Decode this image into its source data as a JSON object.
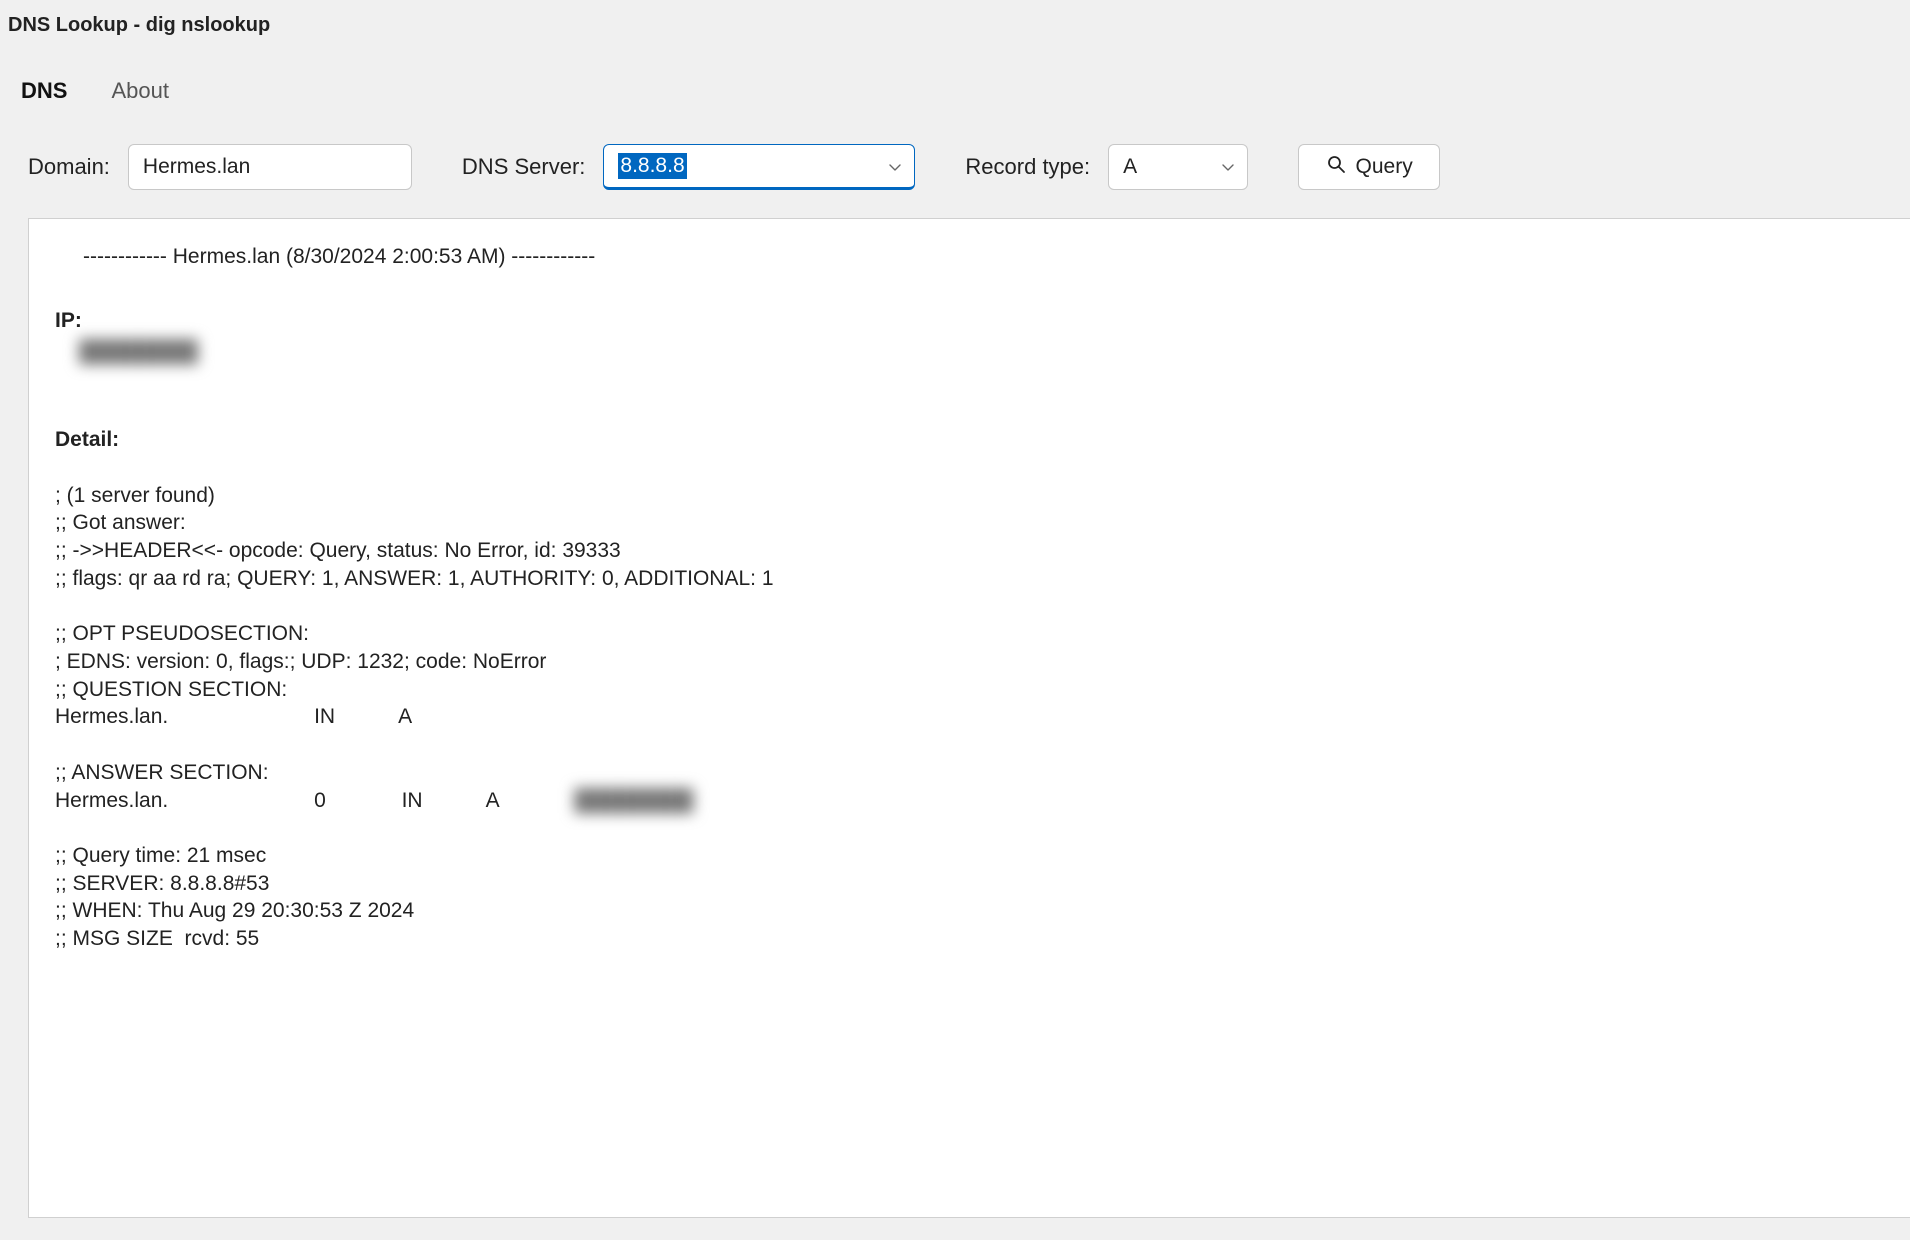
{
  "window": {
    "title": "DNS Lookup - dig nslookup"
  },
  "tabs": {
    "dns": "DNS",
    "about": "About",
    "active": "dns"
  },
  "controls": {
    "domain_label": "Domain:",
    "domain_value": "Hermes.lan",
    "dns_label": "DNS Server:",
    "dns_value": "8.8.8.8",
    "record_label": "Record type:",
    "record_value": "A",
    "query_label": "Query"
  },
  "output": {
    "separator": "------------ Hermes.lan (8/30/2024 2:00:53 AM) ------------",
    "ip_label": "IP:",
    "ip_value_redacted": "████████",
    "detail_label": "Detail:",
    "detail_lines": {
      "l01": "; (1 server found)",
      "l02": ";; Got answer:",
      "l03": ";; ->>HEADER<<- opcode: Query, status: No Error, id: 39333",
      "l04": ";; flags: qr aa rd ra; QUERY: 1, ANSWER: 1, AUTHORITY: 0, ADDITIONAL: 1",
      "l05": ";; OPT PSEUDOSECTION:",
      "l06": "; EDNS: version: 0, flags:; UDP: 1232; code: NoError",
      "l07": ";; QUESTION SECTION:",
      "l08": "Hermes.lan.                         IN           A",
      "l09": ";; ANSWER SECTION:",
      "l10_pre": "Hermes.lan.                         0             IN           A             ",
      "l10_redacted": "████████",
      "l11": ";; Query time: 21 msec",
      "l12": ";; SERVER: 8.8.8.8#53",
      "l13": ";; WHEN: Thu Aug 29 20:30:53 Z 2024",
      "l14": ";; MSG SIZE  rcvd: 55"
    }
  }
}
